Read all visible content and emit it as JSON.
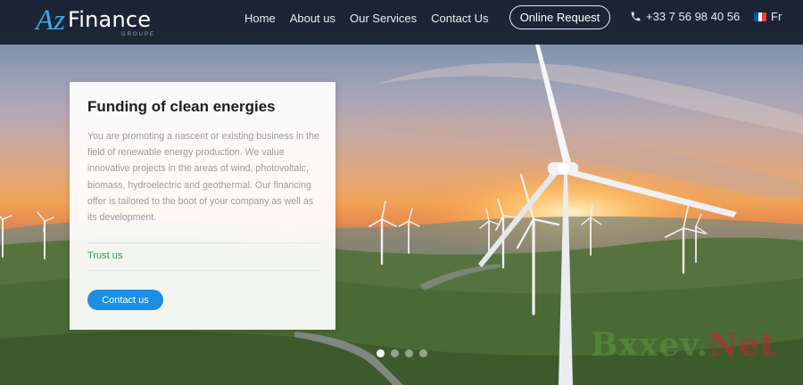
{
  "header": {
    "logo": {
      "brand_az": "Az",
      "brand_rest": "Finance",
      "tagline": "GROUPE"
    },
    "nav": [
      "Home",
      "About us",
      "Our Services",
      "Contact Us"
    ],
    "online_request": "Online Request",
    "phone": "+33 7 56 98 40 56",
    "language": "Fr",
    "icons": {
      "phone": "phone-icon",
      "flag": "france-flag-icon"
    }
  },
  "hero": {
    "title": "Funding of clean energies",
    "description": "You are promoting a nascent or existing business in the field of renewable energy production. We value innovative projects in the areas of wind, photovoltaic, biomass, hydroelectric and geothermal. Our financing offer is tailored to the boot of your company as well as its development.",
    "trust": "Trust us",
    "cta": "Contact us"
  },
  "slider": {
    "slides": 4,
    "active": 1
  },
  "watermark": {
    "part1": "Bxxev.",
    "part2": "Net"
  },
  "colors": {
    "nav_bg": "#161e2e",
    "brand_blue": "#3fa6e8",
    "cta_blue": "#1c8ee3",
    "trust_green": "#2e9a48",
    "flag_blue": "#0055a4",
    "flag_white": "#ffffff",
    "flag_red": "#ef4135"
  }
}
